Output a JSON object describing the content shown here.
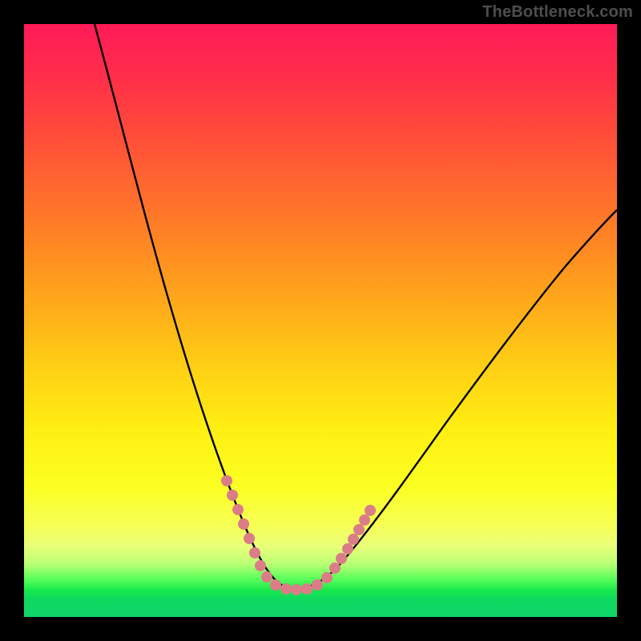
{
  "watermark": "TheBottleneck.com",
  "chart_data": {
    "type": "line",
    "title": "",
    "xlabel": "",
    "ylabel": "",
    "xlim": [
      0,
      100
    ],
    "ylim": [
      0,
      100
    ],
    "grid": false,
    "legend": false,
    "series": [
      {
        "name": "bottleneck-curve",
        "x": [
          12,
          15,
          18,
          21,
          24,
          27,
          30,
          32,
          34,
          36,
          38,
          40,
          42,
          44,
          46,
          48,
          50,
          55,
          60,
          65,
          70,
          75,
          80,
          85,
          90,
          95,
          100
        ],
        "values": [
          100,
          90,
          80,
          70,
          60,
          50,
          41,
          34,
          27,
          21,
          16,
          11,
          8,
          6,
          5,
          5,
          6,
          8,
          13,
          20,
          27,
          34,
          41,
          48,
          54,
          59,
          63
        ]
      },
      {
        "name": "highlight-markers",
        "x": [
          34,
          35,
          36,
          37,
          38,
          39,
          40,
          41,
          42,
          43,
          44,
          45,
          46,
          47,
          48,
          49,
          50,
          51,
          52,
          53,
          54
        ],
        "values": [
          27,
          23,
          19,
          16,
          13,
          11,
          9,
          7,
          6,
          5,
          5,
          5,
          5,
          5,
          6,
          6,
          7,
          8,
          9,
          10,
          12
        ]
      }
    ],
    "background_gradient": {
      "orientation": "vertical",
      "stops": [
        {
          "pos": 0.0,
          "color": "#ff1a58"
        },
        {
          "pos": 0.3,
          "color": "#ff6a2e"
        },
        {
          "pos": 0.6,
          "color": "#ffd014"
        },
        {
          "pos": 0.82,
          "color": "#fbff22"
        },
        {
          "pos": 0.93,
          "color": "#5cff5a"
        },
        {
          "pos": 1.0,
          "color": "#10d66a"
        }
      ]
    },
    "annotations": [
      {
        "text": "TheBottleneck.com",
        "pos": "top-right",
        "color": "#4e4e4e"
      }
    ]
  },
  "colors": {
    "curve": "#000000",
    "markers": "#db7d87",
    "frame": "#000000"
  }
}
